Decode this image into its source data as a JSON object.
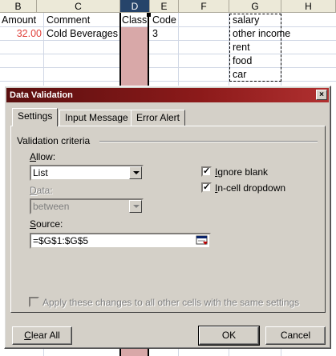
{
  "sheet": {
    "columns": [
      "B",
      "C",
      "D",
      "E",
      "F",
      "G",
      "H"
    ],
    "selected_column": "D",
    "headers": {
      "amount": "Amount",
      "comment": "Comment",
      "class": "Class",
      "code": "Code"
    },
    "row2": {
      "amount": "32.00",
      "comment": "Cold Beverages",
      "code": "3"
    },
    "list_values": [
      "salary",
      "other income",
      "rent",
      "food",
      "car"
    ],
    "colors": {
      "amount_text": "#e0403a",
      "selection_fill": "#d8a8a8",
      "header_selected": "#26446a"
    }
  },
  "dialog": {
    "title": "Data Validation",
    "close_glyph": "×",
    "tabs": [
      "Settings",
      "Input Message",
      "Error Alert"
    ],
    "active_tab": "Settings",
    "group_label": "Validation criteria",
    "allow_label": "Allow:",
    "allow_value": "List",
    "data_label": "Data:",
    "data_value": "between",
    "source_label": "Source:",
    "source_value": "=$G$1:$G$5",
    "ignore_blank_label": "Ignore blank",
    "ignore_blank_checked": true,
    "in_cell_dropdown_label": "In-cell dropdown",
    "in_cell_dropdown_checked": true,
    "apply_all_label": "Apply these changes to all other cells with the same settings",
    "apply_all_checked": false,
    "clear_all_label": "Clear All",
    "ok_label": "OK",
    "cancel_label": "Cancel",
    "check_glyph": "✓"
  }
}
